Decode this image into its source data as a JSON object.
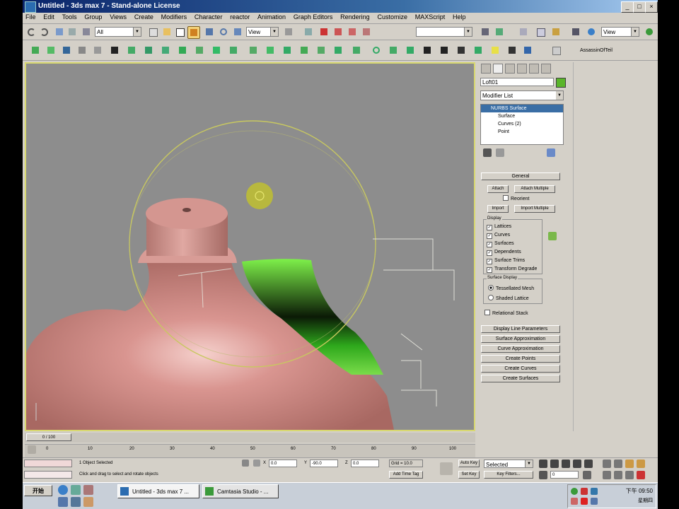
{
  "app": {
    "title": "Untitled - 3ds max 7 - Stand-alone License",
    "window_controls": [
      "_",
      "□",
      "×"
    ]
  },
  "menu": [
    "File",
    "Edit",
    "Tools",
    "Group",
    "Views",
    "Create",
    "Modifiers",
    "Character",
    "reactor",
    "Animation",
    "Graph Editors",
    "Rendering",
    "Customize",
    "MAXScript",
    "Help"
  ],
  "toolbar": {
    "selection_filter": "All",
    "reference_coord": "View",
    "named_selection": "",
    "view_combo": "View",
    "assassin_label": "AssassinOfTeil"
  },
  "command_panel": {
    "object_name": "Loft01",
    "modifier_list": "Modifier List",
    "stack": [
      "NURBS Surface",
      "Surface",
      "Curves (2)",
      "Point"
    ],
    "general_rollout": "General",
    "attach": "Attach",
    "attach_multiple": "Attach Multiple",
    "reorient": "Reorient",
    "import": "Import",
    "import_multiple": "Import Multiple",
    "display_group": "Display",
    "display_options": [
      "Lattices",
      "Curves",
      "Surfaces",
      "Dependents",
      "Surface Trims",
      "Transform Degrade"
    ],
    "surface_display_group": "Surface Display",
    "surface_display_options": [
      "Tessellated Mesh",
      "Shaded Lattice"
    ],
    "relational_stack": "Relational Stack",
    "rollouts": [
      "Display Line Parameters",
      "Surface Approximation",
      "Curve Approximation",
      "Create Points",
      "Create Curves",
      "Create Surfaces"
    ]
  },
  "timeline": {
    "slider_label": "0 / 100",
    "ticks": [
      "0",
      "10",
      "20",
      "30",
      "40",
      "50",
      "60",
      "70",
      "80",
      "90",
      "100"
    ]
  },
  "status": {
    "selected": "1 Object Selected",
    "prompt": "Click and drag to select and rotate objects",
    "left_field": "",
    "x": "0.0",
    "y": "-90.0",
    "z": "0.0",
    "grid": "Grid = 10.0",
    "auto_key": "Auto Key",
    "set_key": "Set Key",
    "selected_combo": "Selected",
    "key_filters": "Key Filters...",
    "add_time_tag": "Add Time Tag",
    "frame": "0"
  },
  "taskbar": {
    "start": "开始",
    "tasks": [
      "Untitled - 3ds max 7 ...",
      "Camtasia Studio - ..."
    ],
    "clock": "下午 09:50",
    "date": "星期四"
  }
}
